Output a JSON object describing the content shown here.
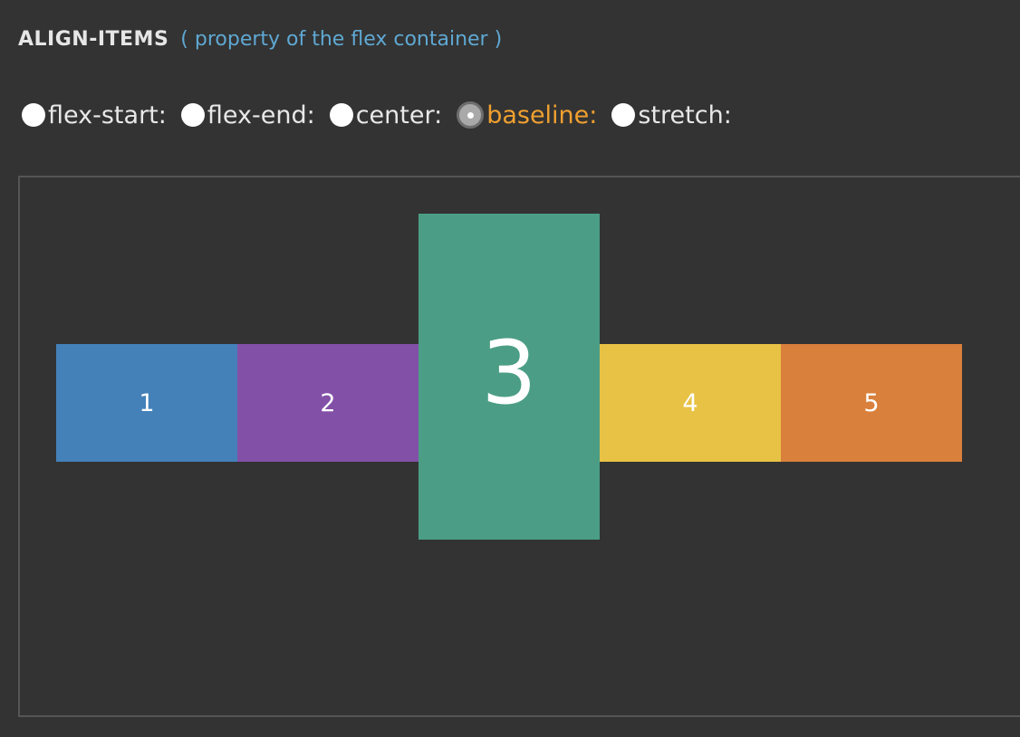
{
  "heading": {
    "property": "ALIGN-ITEMS",
    "subtitle": "( property of the flex container )"
  },
  "options": [
    {
      "label": "flex-start:",
      "selected": false
    },
    {
      "label": "flex-end:",
      "selected": false
    },
    {
      "label": "center:",
      "selected": false
    },
    {
      "label": "baseline:",
      "selected": true
    },
    {
      "label": "stretch:",
      "selected": false
    }
  ],
  "items": [
    {
      "label": "1",
      "color": "#4481b9"
    },
    {
      "label": "2",
      "color": "#8350a8"
    },
    {
      "label": "3",
      "color": "#4b9e85"
    },
    {
      "label": "4",
      "color": "#e8c245"
    },
    {
      "label": "5",
      "color": "#d9803c"
    }
  ],
  "colors": {
    "background": "#333333",
    "accent_selected": "#f0a030",
    "subtitle": "#5fa8d3"
  }
}
